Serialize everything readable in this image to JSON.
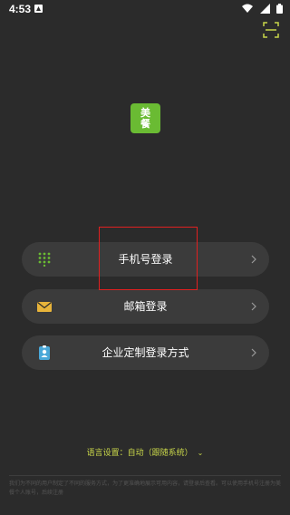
{
  "status_bar": {
    "time": "4:53"
  },
  "header": {
    "scan_icon": "scan-icon"
  },
  "logo": {
    "line1": "美",
    "line2": "餐",
    "color": "#6abb33"
  },
  "login_options": [
    {
      "label": "手机号登录",
      "icon": "dialpad-icon"
    },
    {
      "label": "邮箱登录",
      "icon": "envelope-icon"
    },
    {
      "label": "企业定制登录方式",
      "icon": "badge-icon"
    }
  ],
  "language": {
    "label": "语言设置：自动（跟随系统）",
    "color": "#c8d64a"
  },
  "notice": "我们为不同的用户制定了不同的服务方式，为了更准确地展示可用内容，请登录后查看。可以使用手机号注册为美餐个人账号，后续注册",
  "colors": {
    "background": "#2b2b2b",
    "button": "#3b3b3b",
    "highlight": "#e02020"
  }
}
